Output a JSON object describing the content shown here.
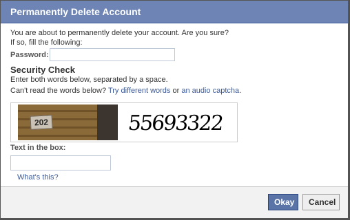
{
  "dialog": {
    "title": "Permanently Delete Account",
    "intro_line1": "You are about to permanently delete your account. Are you sure?",
    "intro_line2": "If so, fill the following:",
    "password_label": "Password:",
    "password_value": "",
    "security_title": "Security Check",
    "instruction": "Enter both words below, separated by a space.",
    "cant_read_prefix": "Can't read the words below?",
    "try_different": "Try different words",
    "or_text": "or",
    "audio_captcha": "an audio captcha",
    "period": ".",
    "captcha_photo_text": "202",
    "captcha_word": "55693322",
    "textbox_label": "Text in the box:",
    "textbox_value": "",
    "whats_this": "What's this?",
    "okay_label": "Okay",
    "cancel_label": "Cancel"
  },
  "colors": {
    "titlebar": "#6d84b4",
    "link": "#3b5998",
    "primary_button": "#5b74a8"
  }
}
